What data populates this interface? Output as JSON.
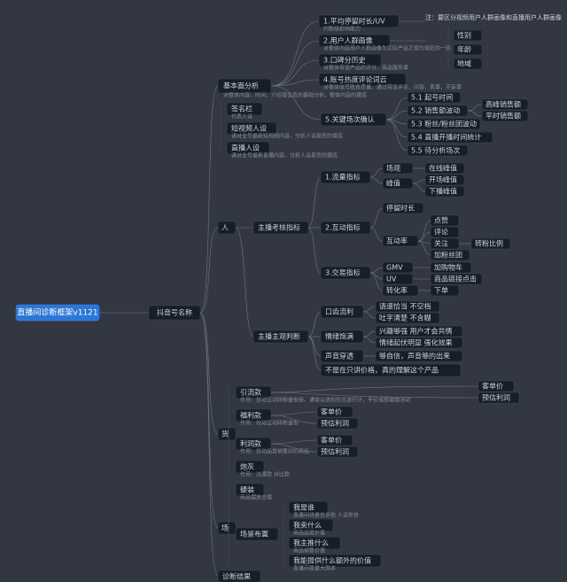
{
  "root": "直播间诊断框架v1121",
  "level1": "抖音号名称",
  "top": {
    "title": "基本面分析",
    "sub": "对整体内容、时间、介绍等信息的基础分析，整体内容的摸底",
    "children": [
      {
        "label": "签名栏",
        "sub": "代表人设"
      },
      {
        "label": "短视频人设",
        "sub": "请对全号最新短视频内容，分析人设是否的摸底"
      },
      {
        "label": "直播人设",
        "sub": "请对全号最新直播内容，分析人设是否的摸底"
      }
    ],
    "right": [
      {
        "label": "1.平均停留时长/UV",
        "sub": "约数级影响能力"
      },
      {
        "label": "2.用户人群画像",
        "sub": "对整体内容用户人群画像为实际产品正规与规范的一致"
      },
      {
        "label": "3.口碑分历史",
        "sub": "对整体带货产品的评分，商品服务章"
      },
      {
        "label": "4.账号热度评论词云",
        "sub": "对整体账号败食质量、通过带货评论、问答、真章、不妄章"
      },
      {
        "label": "5.关键场次确认",
        "children": [
          {
            "label": "5.1 起号时间"
          },
          {
            "label": "5.2 销售额波动",
            "children": [
              "高峰销售额",
              "平时销售额"
            ]
          },
          {
            "label": "5.3 粉丝/粉丝团波动"
          },
          {
            "label": "5.4 直播开播时间统计"
          },
          {
            "label": "5.5 待分析场次"
          }
        ]
      }
    ],
    "note": {
      "title": "注：要区分视频用户人群画像和直播用户人群画像",
      "items": [
        "性别",
        "年龄",
        "地域"
      ]
    }
  },
  "person": {
    "title": "人",
    "assess": {
      "title": "主播考核指标",
      "metrics": [
        {
          "label": "1.流量指标",
          "children": [
            {
              "label": "场观"
            },
            {
              "label": "峰值",
              "children": [
                "在线峰值",
                "开场峰值",
                "下播峰值"
              ]
            }
          ]
        },
        {
          "label": "2.互动指标",
          "children": [
            {
              "label": "停留时长"
            },
            {
              "label": "互动率",
              "children": [
                "点赞",
                "评论",
                "关注",
                "加粉丝团"
              ],
              "extra": "转粉比例"
            }
          ]
        },
        {
          "label": "3.交易指标",
          "children": [
            {
              "label": "GMV",
              "children": [
                "加购物车"
              ]
            },
            {
              "label": "UV",
              "children": [
                "商品链接点击"
              ]
            },
            {
              "label": "转化率",
              "children": [
                "下单"
              ]
            }
          ]
        }
      ]
    },
    "subjective": {
      "title": "主播主观判断",
      "children": [
        {
          "label": "口齿流利",
          "children": [
            "语速恰当 不空档",
            "吐字清楚 不含糊"
          ]
        },
        {
          "label": "情绪饱满",
          "children": [
            "兴趣够强 用户才会共情",
            "情绪起伏明显 强化效果"
          ]
        },
        {
          "label": "声音穿透",
          "children": [
            "够自信，声音够的出来"
          ]
        },
        {
          "label": "不是在只讲价格，真的理解这个产品"
        }
      ]
    }
  },
  "goods": {
    "title": "货",
    "children": [
      {
        "label": "引流款",
        "sub": "作用：拉动互动转粉盘衔接、通常以送的形式进行计，半价或部描描活动",
        "children": [
          "客单价",
          "预估利润"
        ]
      },
      {
        "label": "福利款",
        "sub": "作用：拉动互动转粉盘衔",
        "children": [
          "客单价",
          "预估利润"
        ]
      },
      {
        "label": "利润款",
        "sub": "作用：拉动品类销售好的商品",
        "children": [
          "客单价",
          "预估利润"
        ]
      },
      {
        "label": "炮灰",
        "sub": "作用：过渡款 对比款"
      }
    ]
  },
  "stage": {
    "title": "场",
    "children": [
      {
        "label": "硬装",
        "sub": "商品摆放合理"
      },
      {
        "label": "场景布置",
        "children": [
          {
            "label": "我是谁",
            "sub": "直播间场景告诉他 人设你自"
          },
          {
            "label": "我卖什么",
            "sub": "商品品类价值"
          },
          {
            "label": "我主推什么",
            "sub": "商品销售价值"
          },
          {
            "label": "我能提供什么额外的价值",
            "sub": "直播间是最大购本"
          }
        ]
      }
    ]
  },
  "diag": "诊断结果"
}
